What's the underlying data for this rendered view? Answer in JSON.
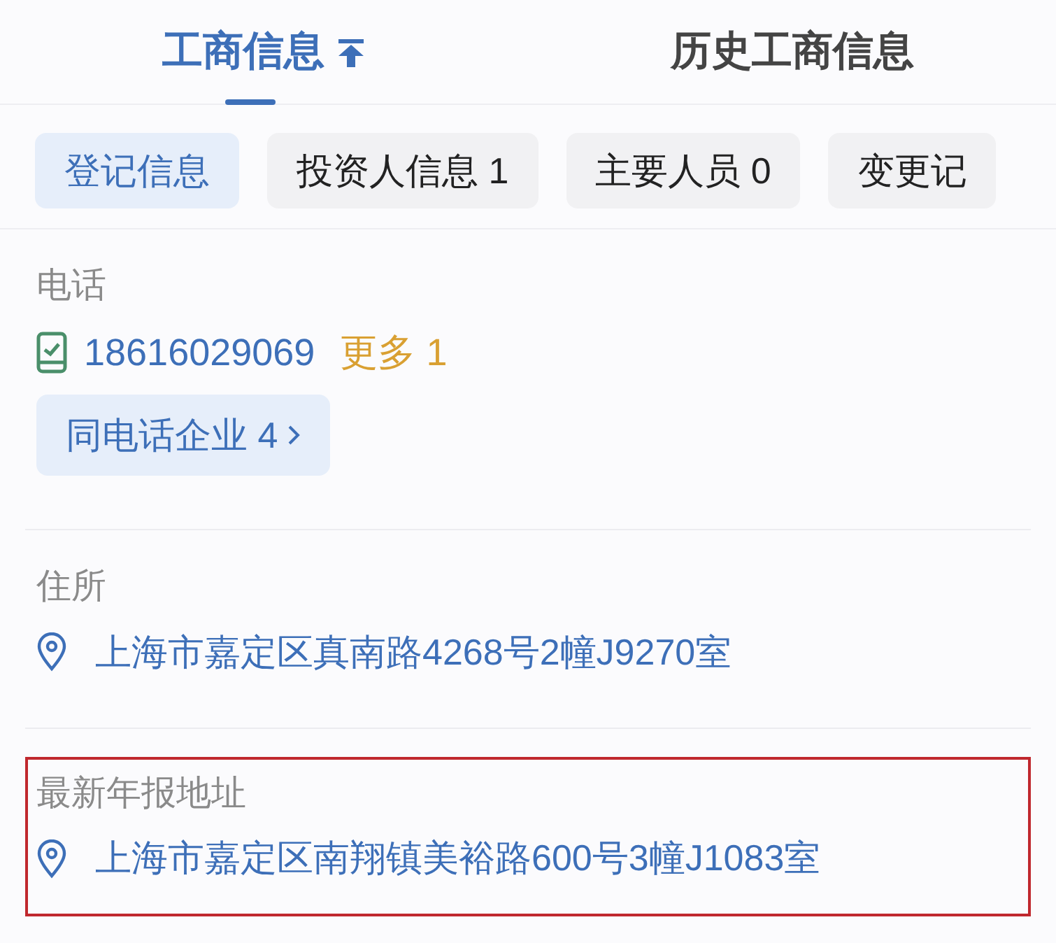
{
  "tabs": [
    {
      "label": "工商信息",
      "selected": true,
      "pinned": true
    },
    {
      "label": "历史工商信息",
      "selected": false,
      "pinned": false
    }
  ],
  "chips": [
    {
      "label": "登记信息",
      "selected": true
    },
    {
      "label": "投资人信息 1",
      "selected": false
    },
    {
      "label": "主要人员 0",
      "selected": false
    },
    {
      "label": "变更记",
      "selected": false
    }
  ],
  "sections": [
    {
      "kind": "phone",
      "label": "电话",
      "value": "18616029069",
      "more": "更多 1",
      "button": "同电话企业 4",
      "highlighted": false
    },
    {
      "kind": "address",
      "label": "住所",
      "value": "上海市嘉定区真南路4268号2幢J9270室",
      "highlighted": false
    },
    {
      "kind": "address",
      "label": "最新年报地址",
      "value": "上海市嘉定区南翔镇美裕路600号3幢J1083室",
      "highlighted": true
    }
  ]
}
